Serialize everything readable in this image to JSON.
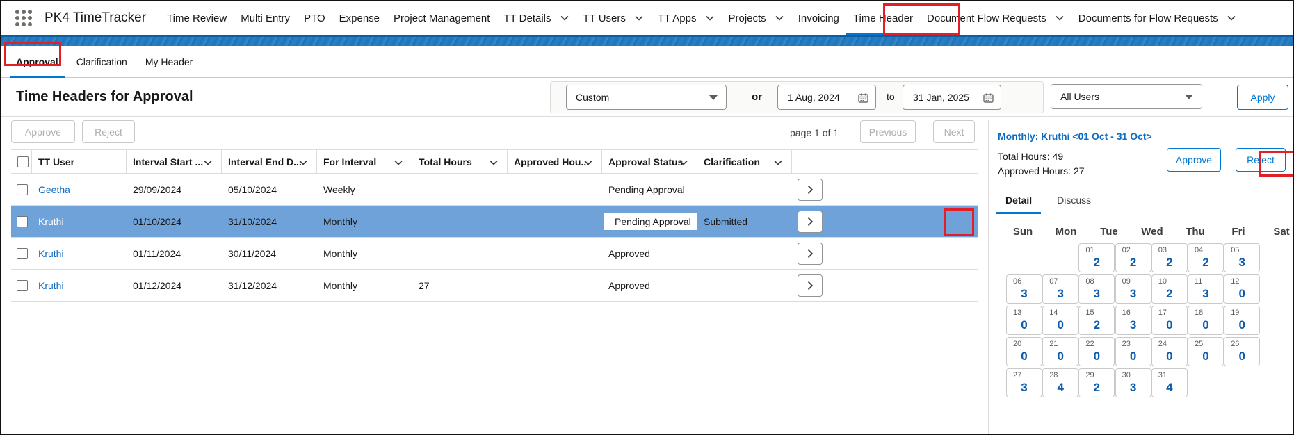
{
  "app": {
    "name": "PK4 TimeTracker"
  },
  "nav": [
    {
      "label": "Time Review",
      "dropdown": false
    },
    {
      "label": "Multi Entry",
      "dropdown": false
    },
    {
      "label": "PTO",
      "dropdown": false
    },
    {
      "label": "Expense",
      "dropdown": false
    },
    {
      "label": "Project Management",
      "dropdown": false
    },
    {
      "label": "TT Details",
      "dropdown": true
    },
    {
      "label": "TT Users",
      "dropdown": true
    },
    {
      "label": "TT Apps",
      "dropdown": true
    },
    {
      "label": "Projects",
      "dropdown": true
    },
    {
      "label": "Invoicing",
      "dropdown": false
    },
    {
      "label": "Time Header",
      "dropdown": false,
      "active": true
    },
    {
      "label": "Document Flow Requests",
      "dropdown": true
    },
    {
      "label": "Documents for Flow Requests",
      "dropdown": true
    }
  ],
  "subtabs": [
    "Approval",
    "Clarification",
    "My Header"
  ],
  "header": {
    "title": "Time Headers for Approval",
    "period_select": "Custom",
    "or_label": "or",
    "date_from": "1 Aug, 2024",
    "to_label": "to",
    "date_to": "31 Jan, 2025",
    "users_select": "All Users",
    "apply_label": "Apply"
  },
  "toolbar": {
    "approve_label": "Approve",
    "reject_label": "Reject",
    "page_info": "page 1 of 1",
    "previous_label": "Previous",
    "next_label": "Next"
  },
  "table": {
    "columns": [
      "TT User",
      "Interval Start ...",
      "Interval End D...",
      "For Interval",
      "Total Hours",
      "Approved Hou...",
      "Approval Status",
      "Clarification"
    ],
    "rows": [
      {
        "user": "Geetha",
        "start": "29/09/2024",
        "end": "05/10/2024",
        "interval": "Weekly",
        "total": "",
        "approved": "",
        "status": "Pending Approval",
        "clarification": "",
        "selected": false
      },
      {
        "user": "Kruthi",
        "start": "01/10/2024",
        "end": "31/10/2024",
        "interval": "Monthly",
        "total": "",
        "approved": "",
        "status": "Pending Approval",
        "clarification": "Submitted",
        "selected": true
      },
      {
        "user": "Kruthi",
        "start": "01/11/2024",
        "end": "30/11/2024",
        "interval": "Monthly",
        "total": "",
        "approved": "",
        "status": "Approved",
        "clarification": "",
        "selected": false
      },
      {
        "user": "Kruthi",
        "start": "01/12/2024",
        "end": "31/12/2024",
        "interval": "Monthly",
        "total": "27",
        "approved": "",
        "status": "Approved",
        "clarification": "",
        "selected": false
      }
    ]
  },
  "detail": {
    "title": "Monthly: Kruthi <01 Oct - 31 Oct>",
    "total_hours": "Total Hours: 49",
    "approved_hours": "Approved Hours: 27",
    "approve_label": "Approve",
    "reject_label": "Reject",
    "tabs": [
      "Detail",
      "Discuss"
    ],
    "weekdays": [
      "Sun",
      "Mon",
      "Tue",
      "Wed",
      "Thu",
      "Fri",
      "Sat"
    ],
    "first_weekday_index": 2,
    "days": [
      {
        "day": "01",
        "hours": "2"
      },
      {
        "day": "02",
        "hours": "2"
      },
      {
        "day": "03",
        "hours": "2"
      },
      {
        "day": "04",
        "hours": "2"
      },
      {
        "day": "05",
        "hours": "3"
      },
      {
        "day": "06",
        "hours": "3"
      },
      {
        "day": "07",
        "hours": "3"
      },
      {
        "day": "08",
        "hours": "3"
      },
      {
        "day": "09",
        "hours": "3"
      },
      {
        "day": "10",
        "hours": "2"
      },
      {
        "day": "11",
        "hours": "3"
      },
      {
        "day": "12",
        "hours": "0"
      },
      {
        "day": "13",
        "hours": "0"
      },
      {
        "day": "14",
        "hours": "0"
      },
      {
        "day": "15",
        "hours": "2"
      },
      {
        "day": "16",
        "hours": "3"
      },
      {
        "day": "17",
        "hours": "0"
      },
      {
        "day": "18",
        "hours": "0"
      },
      {
        "day": "19",
        "hours": "0"
      },
      {
        "day": "20",
        "hours": "0"
      },
      {
        "day": "21",
        "hours": "0"
      },
      {
        "day": "22",
        "hours": "0"
      },
      {
        "day": "23",
        "hours": "0"
      },
      {
        "day": "24",
        "hours": "0"
      },
      {
        "day": "25",
        "hours": "0"
      },
      {
        "day": "26",
        "hours": "0"
      },
      {
        "day": "27",
        "hours": "3"
      },
      {
        "day": "28",
        "hours": "4"
      },
      {
        "day": "29",
        "hours": "2"
      },
      {
        "day": "30",
        "hours": "3"
      },
      {
        "day": "31",
        "hours": "4"
      }
    ]
  },
  "colors": {
    "accent": "#0176d3",
    "link": "#0b6cc4",
    "selected_row": "#6fa2d8",
    "highlight_box": "#e21f26"
  }
}
